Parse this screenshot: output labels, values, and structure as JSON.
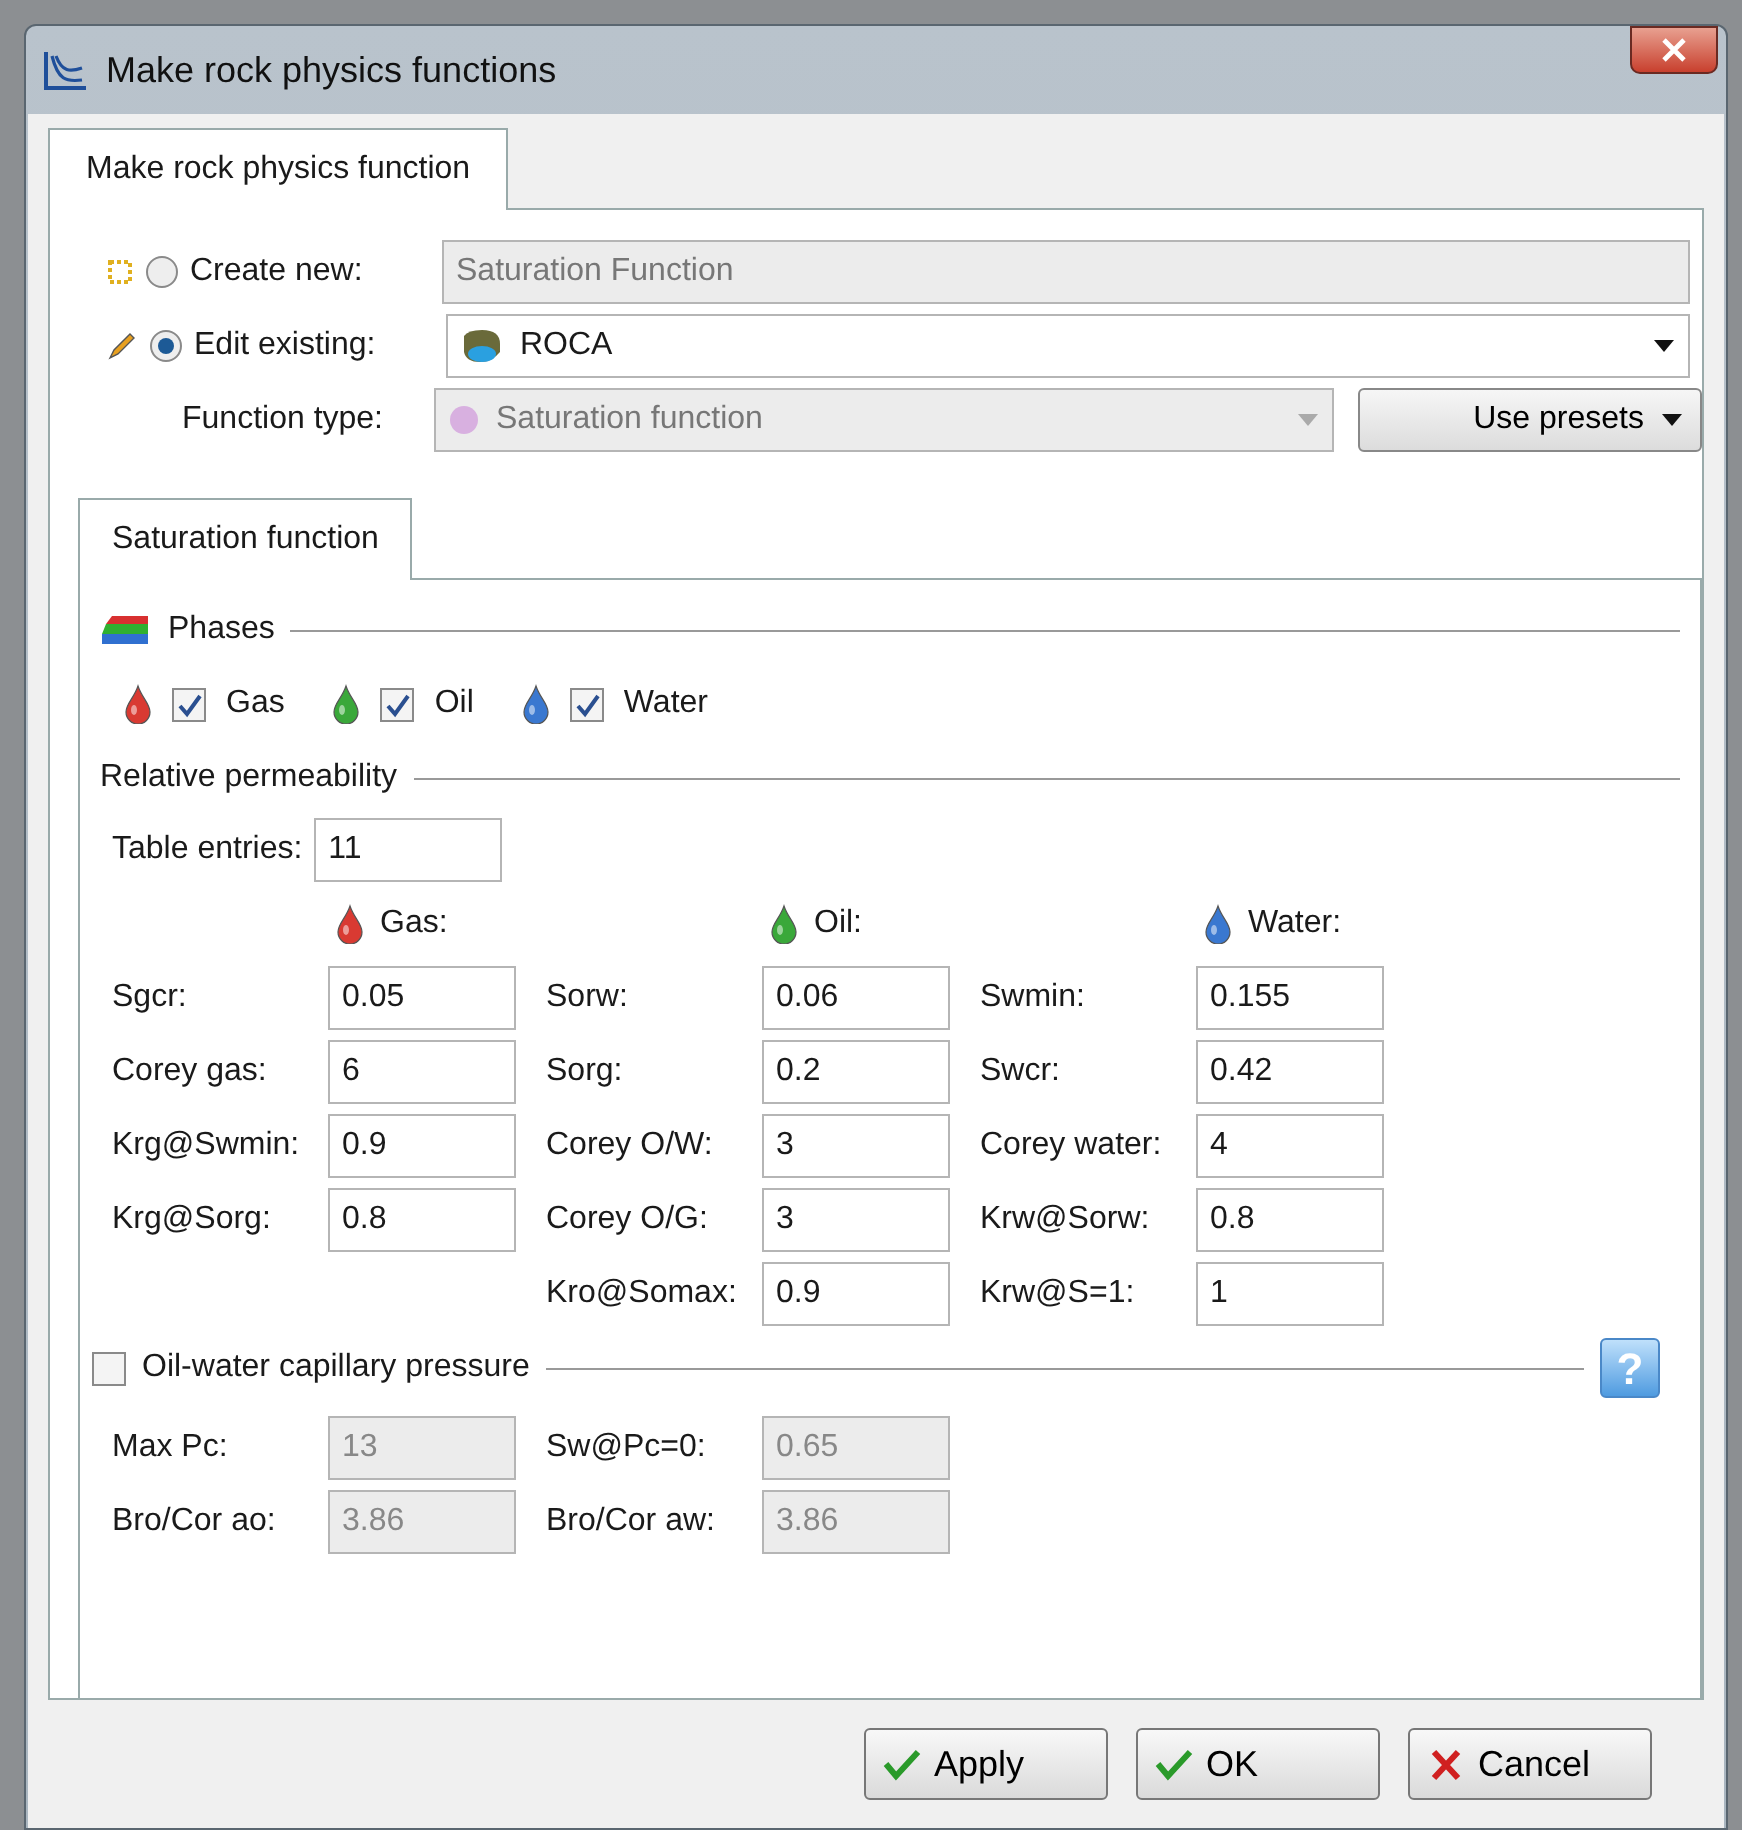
{
  "window": {
    "title": "Make rock physics functions"
  },
  "outer_tabs": [
    {
      "label": "Make rock physics function",
      "selected": true
    }
  ],
  "modes": [
    {
      "kind": "create",
      "label": "Create new:",
      "selected": false,
      "value": "Saturation Function"
    },
    {
      "kind": "edit",
      "label": "Edit existing:",
      "selected": true,
      "value": "ROCA"
    }
  ],
  "function_type": {
    "label": "Function type:",
    "value": "Saturation function",
    "disabled": true
  },
  "presets_button": "Use presets",
  "inner_tabs": [
    {
      "label": "Saturation function",
      "selected": true
    }
  ],
  "phases": {
    "title": "Phases",
    "items": [
      {
        "label": "Gas",
        "checked": true,
        "color": "#d93a32"
      },
      {
        "label": "Oil",
        "checked": true,
        "color": "#3aa83a"
      },
      {
        "label": "Water",
        "checked": true,
        "color": "#3a78d0"
      }
    ]
  },
  "relperm": {
    "title": "Relative permeability",
    "table_entries": {
      "label": "Table entries:",
      "value": "11"
    },
    "columns": [
      {
        "header": "Gas:",
        "color": "#d93a32",
        "fields": [
          {
            "label": "Sgcr:",
            "value": "0.05"
          },
          {
            "label": "Corey gas:",
            "value": "6"
          },
          {
            "label": "Krg@Swmin:",
            "value": "0.9"
          },
          {
            "label": "Krg@Sorg:",
            "value": "0.8"
          }
        ]
      },
      {
        "header": "Oil:",
        "color": "#3aa83a",
        "fields": [
          {
            "label": "Sorw:",
            "value": "0.06"
          },
          {
            "label": "Sorg:",
            "value": "0.2"
          },
          {
            "label": "Corey O/W:",
            "value": "3"
          },
          {
            "label": "Corey O/G:",
            "value": "3"
          },
          {
            "label": "Kro@Somax:",
            "value": "0.9"
          }
        ]
      },
      {
        "header": "Water:",
        "color": "#3a78d0",
        "fields": [
          {
            "label": "Swmin:",
            "value": "0.155"
          },
          {
            "label": "Swcr:",
            "value": "0.42"
          },
          {
            "label": "Corey water:",
            "value": "4"
          },
          {
            "label": "Krw@Sorw:",
            "value": "0.8"
          },
          {
            "label": "Krw@S=1:",
            "value": "1"
          }
        ]
      }
    ]
  },
  "capillary": {
    "label": "Oil-water capillary pressure",
    "checked": false,
    "help": "?",
    "columns": [
      {
        "fields": [
          {
            "label": "Max Pc:",
            "value": "13"
          },
          {
            "label": "Bro/Cor ao:",
            "value": "3.86"
          }
        ]
      },
      {
        "fields": [
          {
            "label": "Sw@Pc=0:",
            "value": "0.65"
          },
          {
            "label": "Bro/Cor aw:",
            "value": "3.86"
          }
        ]
      }
    ]
  },
  "buttons": [
    {
      "kind": "apply",
      "label": "Apply"
    },
    {
      "kind": "ok",
      "label": "OK"
    },
    {
      "kind": "cancel",
      "label": "Cancel"
    }
  ]
}
